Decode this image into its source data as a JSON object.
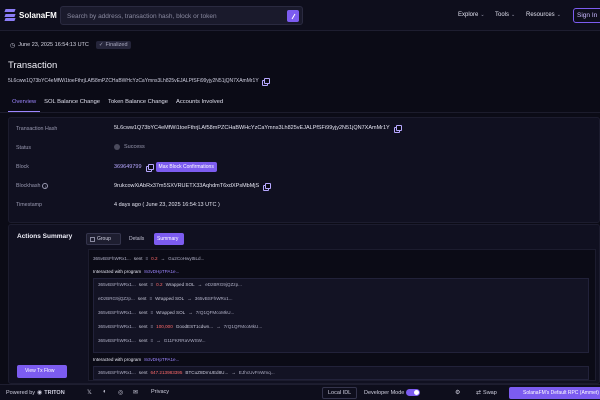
{
  "header": {
    "logo_text": "SolanaFM",
    "search_placeholder": "Search by address, transaction hash, block or token",
    "nav": [
      "Explore",
      "Tools",
      "Resources"
    ],
    "signin_label": "Sign In"
  },
  "status": {
    "timestamp": "June 23, 2025 16:54:13 UTC",
    "finality": "Finalized"
  },
  "transaction": {
    "title": "Transaction",
    "signature": "5L6cww1Q73bYC4eMfWi1toeFthrjLAf58mPZCHaBWHcYzCaYmns3Lh825vEJALPfSFi99yjy2N51jQN7XAmMr1Y"
  },
  "tabs": [
    "Overview",
    "SOL Balance Change",
    "Token Balance Change",
    "Accounts Involved"
  ],
  "overview": {
    "hash_label": "Transaction Hash",
    "hash_value": "5L6cww1Q73bYC4eMfWi1toeFthrjLAf58mPZCHaBWHcYzCaYmns3Lh825vEJALPfSFi99yjy2N51jQN7XAmMr1Y",
    "status_label": "Status",
    "status_value": "Success",
    "block_label": "Block",
    "block_value": "369649799",
    "block_button": "Max Block Confirmations",
    "blockhash_label": "Blockhash",
    "blockhash_value": "9rukcowXiAbRx37m5SXVRUETX33AqhdmT6xdXPsMbMjS",
    "timestamp_label": "Timestamp",
    "timestamp_value": "4 days ago ( June 23, 2025 16:54:13 UTC )"
  },
  "actions": {
    "title": "Actions Summary",
    "group_label": "Group",
    "details_label": "Details",
    "summary_label": "Summary",
    "view_tx_flow": "View Tx Flow",
    "lines": [
      {
        "from": "365vBSFhWRx1...",
        "verb": "sent",
        "amount": "0.2",
        "token": "",
        "to": "Gu2CoHwyt5Ld..."
      },
      {
        "from": "365vBSFhWRx1...",
        "verb": "sent",
        "amount": "0.2",
        "token": "Wrapped SOL",
        "to": "eDzBRG9jQZzp..."
      },
      {
        "from": "eDzBRG9jQZzp...",
        "verb": "sent",
        "amount": "",
        "token": "Wrapped SOL",
        "to": "365vBSFhWRx1..."
      },
      {
        "from": "365vBSFhWRx1...",
        "verb": "sent",
        "amount": "",
        "token": "Wrapped SOL",
        "to": "7rQ1QFMcoMkU..."
      },
      {
        "from": "365vBSFhWRx1...",
        "verb": "sent",
        "amount": "100,000",
        "token": "GoodEST1cdwn...",
        "to": "7rQ1QFMcoMkU..."
      },
      {
        "from": "365vBSFhWRx1...",
        "verb": "sent",
        "amount": "",
        "token": "",
        "to": "G11FKRRaVWSW..."
      },
      {
        "from": "365vBSFhWRx1...",
        "verb": "sent",
        "amount": "647.213983395",
        "token": "BTCuZ8DmUEd8U...",
        "to": "EJhcUvFnWmq..."
      }
    ],
    "program_label": "Interacted with program",
    "program_value": "8ctvDHpTPA1e..."
  },
  "footer": {
    "powered_by": "Powered by",
    "triton": "TRITON",
    "privacy": "Privacy",
    "local_idl": "Local IDL",
    "developer_mode": "Developer Mode",
    "swap": "Swap",
    "rpc_label": "SolanaFM's Default RPC (Ammet)"
  },
  "colors": {
    "accent": "#7c5cf0",
    "link": "#9d86ff",
    "negative": "#ff6a6a",
    "background": "#0b0b16"
  }
}
